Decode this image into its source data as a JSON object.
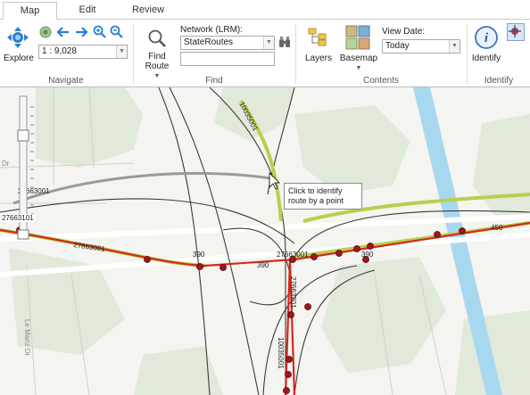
{
  "tabs": [
    "Map",
    "Edit",
    "Review"
  ],
  "navigate": {
    "explore_label": "Explore",
    "scale_value": "1 : 9,028",
    "group_label": "Navigate"
  },
  "find": {
    "find_route_label_1": "Find",
    "find_route_label_2": "Route",
    "network_label": "Network (LRM):",
    "network_value": "StateRoutes",
    "search_placeholder": "",
    "group_label": "Find"
  },
  "contents": {
    "layers_label": "Layers",
    "basemap_label": "Basemap",
    "view_date_label": "View Date:",
    "view_date_value": "Today",
    "group_label": "Contents"
  },
  "identify": {
    "identify_label": "Identify",
    "group_label": "Identify"
  },
  "map": {
    "tooltip_line1": "Click to identify",
    "tooltip_line2": "route by a point",
    "route_labels": [
      "10035001",
      "27663001",
      "27663001",
      "27663001",
      "27663201",
      "10035001",
      "390",
      "390",
      "390",
      "450"
    ],
    "street_labels": [
      "Le Manz Dr",
      "Dr"
    ],
    "scale_tag": "27663101"
  },
  "colors": {
    "route_red": "#d42a1e",
    "route_green": "#b8cf4c",
    "point_fill": "#a3151c",
    "water": "#a8d8f0",
    "vegetation": "#dfe8d8"
  }
}
